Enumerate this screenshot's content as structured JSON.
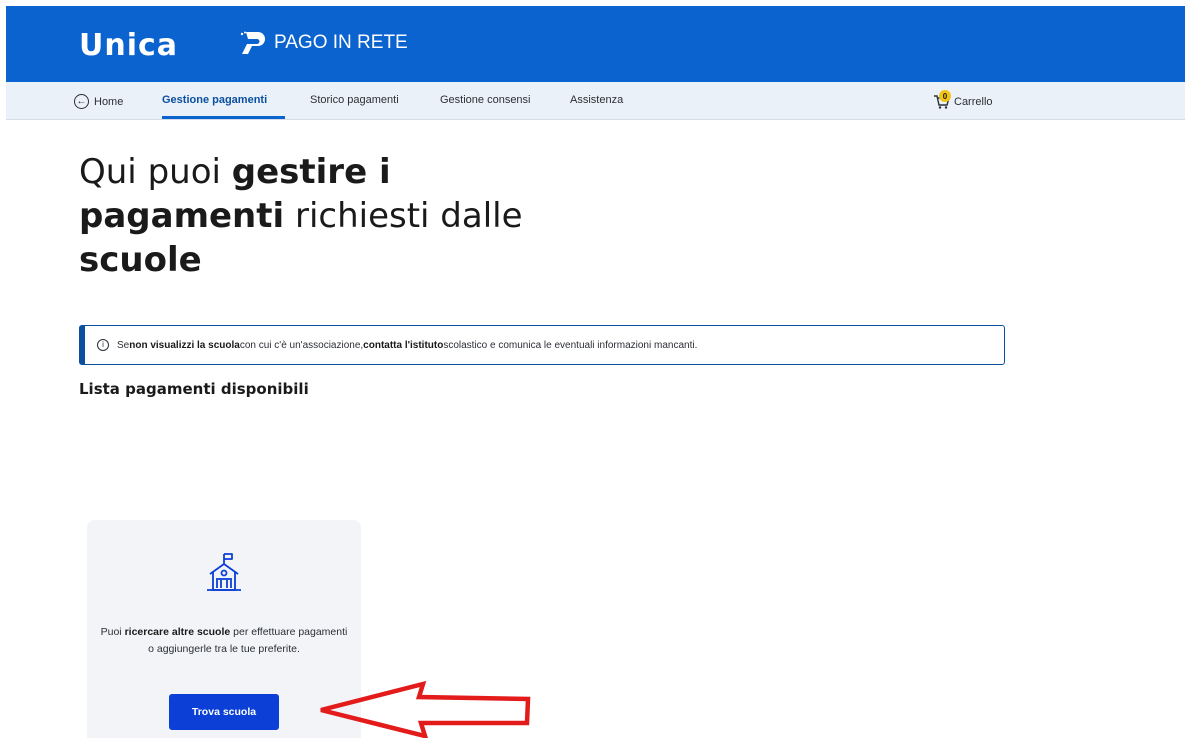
{
  "header": {
    "brand": "Unica",
    "service": "PAGO IN RETE",
    "colors": {
      "header_bg": "#0b63cf",
      "nav_bg": "#eaf1f9",
      "accent": "#0b3fd6",
      "annotation": "#e31b1b"
    }
  },
  "nav": {
    "home": "Home",
    "items": [
      {
        "label": "Gestione pagamenti",
        "active": true
      },
      {
        "label": "Storico pagamenti"
      },
      {
        "label": "Gestione consensi"
      },
      {
        "label": "Assistenza"
      }
    ],
    "cart": {
      "label": "Carrello",
      "count": "0"
    }
  },
  "hero": {
    "part1": "Qui puoi ",
    "bold1": "gestire i",
    "bold2": "pagamenti",
    "part2": " richiesti dalle",
    "bold3": "scuole"
  },
  "alert": {
    "t1": "Se ",
    "b1": "non visualizzi la scuola",
    "t2": " con cui c'è un'associazione, ",
    "b2": "contatta l'istituto",
    "t3": " scolastico e comunica le eventuali informazioni mancanti."
  },
  "list_title": "Lista pagamenti disponibili",
  "card": {
    "t1": "Puoi ",
    "b1": "ricercare altre scuole",
    "t2": " per effettuare pagamenti o aggiungerle tra le tue preferite.",
    "button": "Trova scuola",
    "icon": "school-building-icon"
  }
}
